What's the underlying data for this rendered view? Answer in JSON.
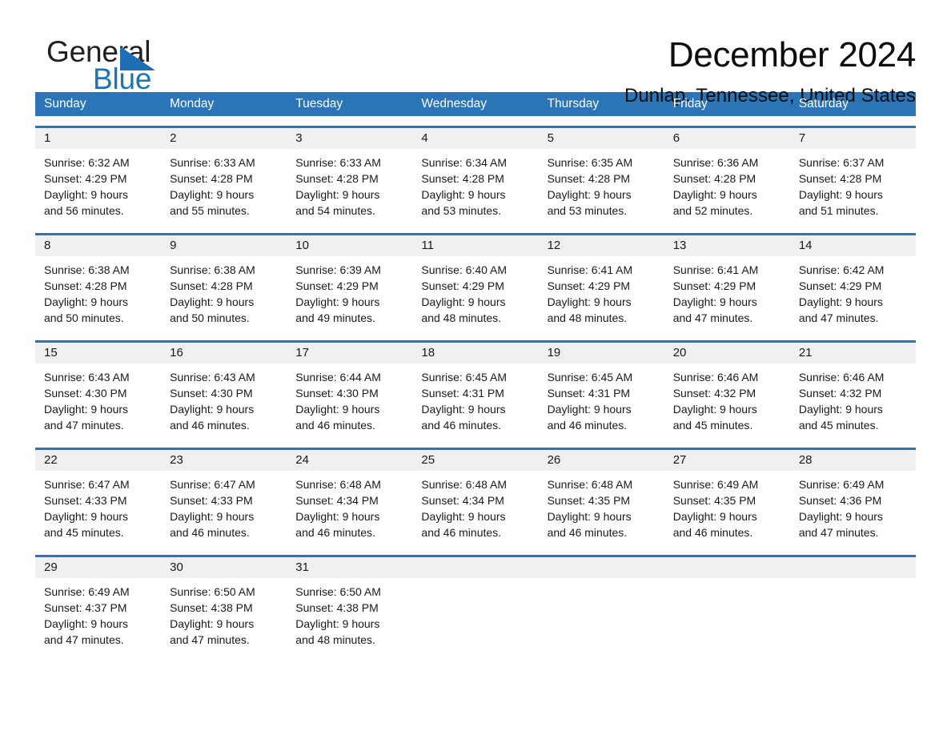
{
  "brand": {
    "name_top": "General",
    "name_bottom": "Blue",
    "accent_color": "#1b75bb",
    "header_color": "#2b74b8"
  },
  "header": {
    "title": "December 2024",
    "location": "Dunlap, Tennessee, United States"
  },
  "calendar": {
    "weekday_headers": [
      "Sunday",
      "Monday",
      "Tuesday",
      "Wednesday",
      "Thursday",
      "Friday",
      "Saturday"
    ],
    "weeks": [
      [
        {
          "day": "1",
          "sunrise": "Sunrise: 6:32 AM",
          "sunset": "Sunset: 4:29 PM",
          "daylight1": "Daylight: 9 hours",
          "daylight2": "and 56 minutes."
        },
        {
          "day": "2",
          "sunrise": "Sunrise: 6:33 AM",
          "sunset": "Sunset: 4:28 PM",
          "daylight1": "Daylight: 9 hours",
          "daylight2": "and 55 minutes."
        },
        {
          "day": "3",
          "sunrise": "Sunrise: 6:33 AM",
          "sunset": "Sunset: 4:28 PM",
          "daylight1": "Daylight: 9 hours",
          "daylight2": "and 54 minutes."
        },
        {
          "day": "4",
          "sunrise": "Sunrise: 6:34 AM",
          "sunset": "Sunset: 4:28 PM",
          "daylight1": "Daylight: 9 hours",
          "daylight2": "and 53 minutes."
        },
        {
          "day": "5",
          "sunrise": "Sunrise: 6:35 AM",
          "sunset": "Sunset: 4:28 PM",
          "daylight1": "Daylight: 9 hours",
          "daylight2": "and 53 minutes."
        },
        {
          "day": "6",
          "sunrise": "Sunrise: 6:36 AM",
          "sunset": "Sunset: 4:28 PM",
          "daylight1": "Daylight: 9 hours",
          "daylight2": "and 52 minutes."
        },
        {
          "day": "7",
          "sunrise": "Sunrise: 6:37 AM",
          "sunset": "Sunset: 4:28 PM",
          "daylight1": "Daylight: 9 hours",
          "daylight2": "and 51 minutes."
        }
      ],
      [
        {
          "day": "8",
          "sunrise": "Sunrise: 6:38 AM",
          "sunset": "Sunset: 4:28 PM",
          "daylight1": "Daylight: 9 hours",
          "daylight2": "and 50 minutes."
        },
        {
          "day": "9",
          "sunrise": "Sunrise: 6:38 AM",
          "sunset": "Sunset: 4:28 PM",
          "daylight1": "Daylight: 9 hours",
          "daylight2": "and 50 minutes."
        },
        {
          "day": "10",
          "sunrise": "Sunrise: 6:39 AM",
          "sunset": "Sunset: 4:29 PM",
          "daylight1": "Daylight: 9 hours",
          "daylight2": "and 49 minutes."
        },
        {
          "day": "11",
          "sunrise": "Sunrise: 6:40 AM",
          "sunset": "Sunset: 4:29 PM",
          "daylight1": "Daylight: 9 hours",
          "daylight2": "and 48 minutes."
        },
        {
          "day": "12",
          "sunrise": "Sunrise: 6:41 AM",
          "sunset": "Sunset: 4:29 PM",
          "daylight1": "Daylight: 9 hours",
          "daylight2": "and 48 minutes."
        },
        {
          "day": "13",
          "sunrise": "Sunrise: 6:41 AM",
          "sunset": "Sunset: 4:29 PM",
          "daylight1": "Daylight: 9 hours",
          "daylight2": "and 47 minutes."
        },
        {
          "day": "14",
          "sunrise": "Sunrise: 6:42 AM",
          "sunset": "Sunset: 4:29 PM",
          "daylight1": "Daylight: 9 hours",
          "daylight2": "and 47 minutes."
        }
      ],
      [
        {
          "day": "15",
          "sunrise": "Sunrise: 6:43 AM",
          "sunset": "Sunset: 4:30 PM",
          "daylight1": "Daylight: 9 hours",
          "daylight2": "and 47 minutes."
        },
        {
          "day": "16",
          "sunrise": "Sunrise: 6:43 AM",
          "sunset": "Sunset: 4:30 PM",
          "daylight1": "Daylight: 9 hours",
          "daylight2": "and 46 minutes."
        },
        {
          "day": "17",
          "sunrise": "Sunrise: 6:44 AM",
          "sunset": "Sunset: 4:30 PM",
          "daylight1": "Daylight: 9 hours",
          "daylight2": "and 46 minutes."
        },
        {
          "day": "18",
          "sunrise": "Sunrise: 6:45 AM",
          "sunset": "Sunset: 4:31 PM",
          "daylight1": "Daylight: 9 hours",
          "daylight2": "and 46 minutes."
        },
        {
          "day": "19",
          "sunrise": "Sunrise: 6:45 AM",
          "sunset": "Sunset: 4:31 PM",
          "daylight1": "Daylight: 9 hours",
          "daylight2": "and 46 minutes."
        },
        {
          "day": "20",
          "sunrise": "Sunrise: 6:46 AM",
          "sunset": "Sunset: 4:32 PM",
          "daylight1": "Daylight: 9 hours",
          "daylight2": "and 45 minutes."
        },
        {
          "day": "21",
          "sunrise": "Sunrise: 6:46 AM",
          "sunset": "Sunset: 4:32 PM",
          "daylight1": "Daylight: 9 hours",
          "daylight2": "and 45 minutes."
        }
      ],
      [
        {
          "day": "22",
          "sunrise": "Sunrise: 6:47 AM",
          "sunset": "Sunset: 4:33 PM",
          "daylight1": "Daylight: 9 hours",
          "daylight2": "and 45 minutes."
        },
        {
          "day": "23",
          "sunrise": "Sunrise: 6:47 AM",
          "sunset": "Sunset: 4:33 PM",
          "daylight1": "Daylight: 9 hours",
          "daylight2": "and 46 minutes."
        },
        {
          "day": "24",
          "sunrise": "Sunrise: 6:48 AM",
          "sunset": "Sunset: 4:34 PM",
          "daylight1": "Daylight: 9 hours",
          "daylight2": "and 46 minutes."
        },
        {
          "day": "25",
          "sunrise": "Sunrise: 6:48 AM",
          "sunset": "Sunset: 4:34 PM",
          "daylight1": "Daylight: 9 hours",
          "daylight2": "and 46 minutes."
        },
        {
          "day": "26",
          "sunrise": "Sunrise: 6:48 AM",
          "sunset": "Sunset: 4:35 PM",
          "daylight1": "Daylight: 9 hours",
          "daylight2": "and 46 minutes."
        },
        {
          "day": "27",
          "sunrise": "Sunrise: 6:49 AM",
          "sunset": "Sunset: 4:35 PM",
          "daylight1": "Daylight: 9 hours",
          "daylight2": "and 46 minutes."
        },
        {
          "day": "28",
          "sunrise": "Sunrise: 6:49 AM",
          "sunset": "Sunset: 4:36 PM",
          "daylight1": "Daylight: 9 hours",
          "daylight2": "and 47 minutes."
        }
      ],
      [
        {
          "day": "29",
          "sunrise": "Sunrise: 6:49 AM",
          "sunset": "Sunset: 4:37 PM",
          "daylight1": "Daylight: 9 hours",
          "daylight2": "and 47 minutes."
        },
        {
          "day": "30",
          "sunrise": "Sunrise: 6:50 AM",
          "sunset": "Sunset: 4:38 PM",
          "daylight1": "Daylight: 9 hours",
          "daylight2": "and 47 minutes."
        },
        {
          "day": "31",
          "sunrise": "Sunrise: 6:50 AM",
          "sunset": "Sunset: 4:38 PM",
          "daylight1": "Daylight: 9 hours",
          "daylight2": "and 48 minutes."
        },
        {
          "day": "",
          "sunrise": "",
          "sunset": "",
          "daylight1": "",
          "daylight2": ""
        },
        {
          "day": "",
          "sunrise": "",
          "sunset": "",
          "daylight1": "",
          "daylight2": ""
        },
        {
          "day": "",
          "sunrise": "",
          "sunset": "",
          "daylight1": "",
          "daylight2": ""
        },
        {
          "day": "",
          "sunrise": "",
          "sunset": "",
          "daylight1": "",
          "daylight2": ""
        }
      ]
    ]
  }
}
